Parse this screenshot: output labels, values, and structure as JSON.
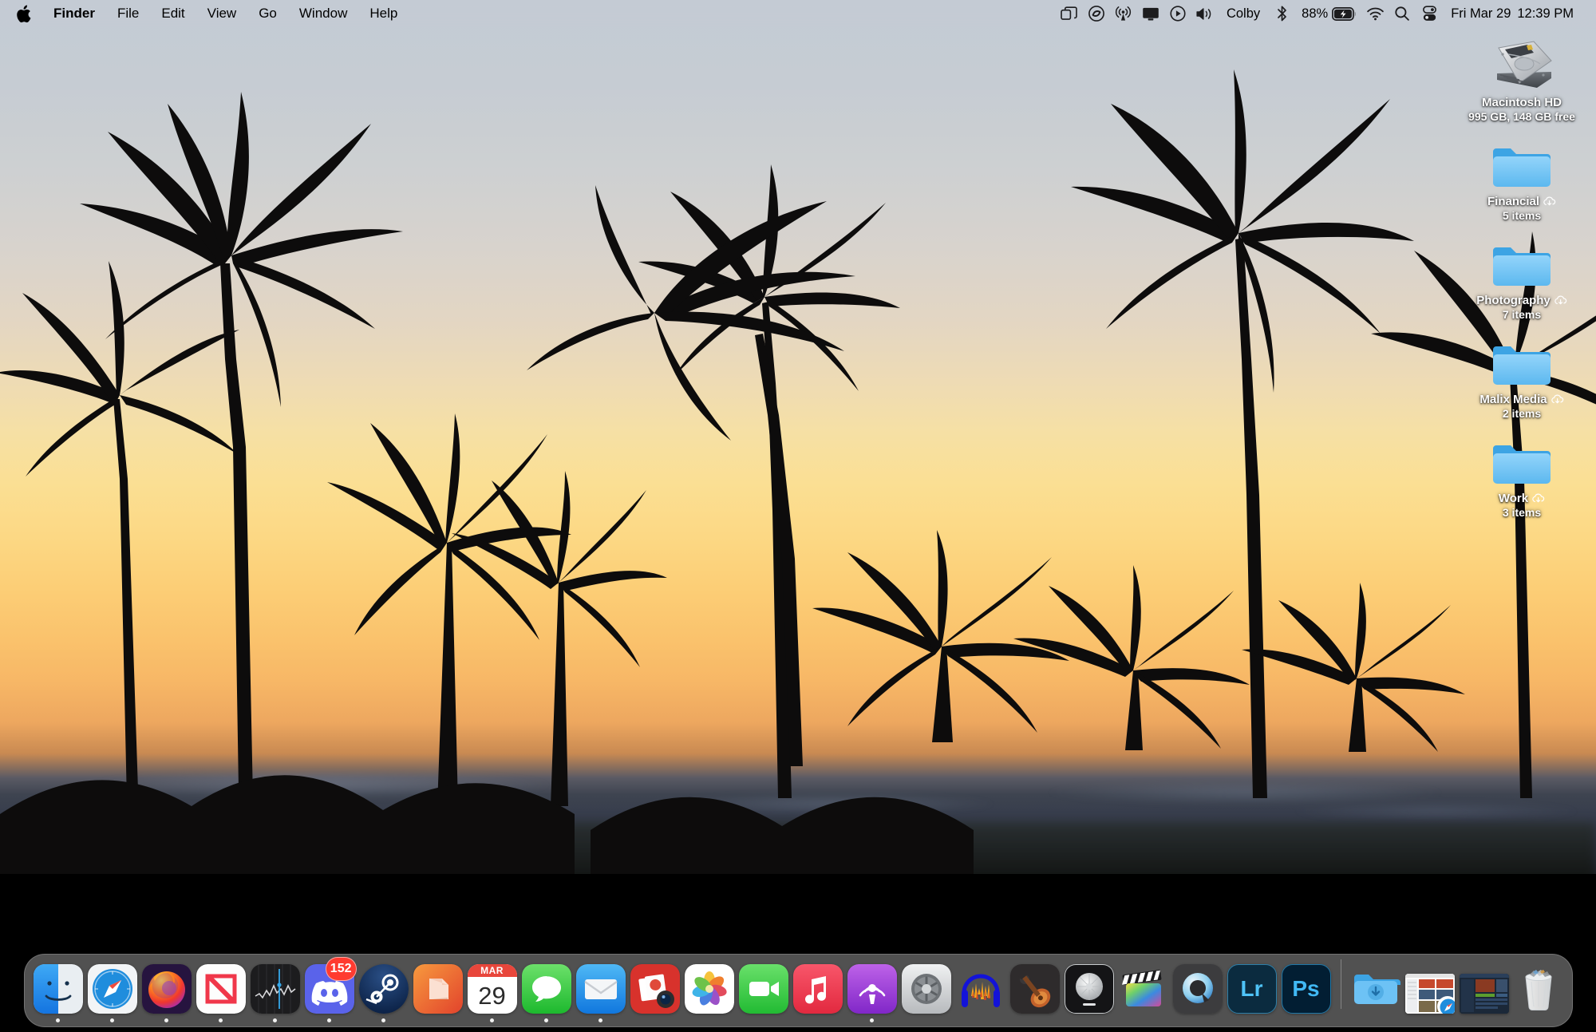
{
  "menubar": {
    "apple_icon": "apple-logo",
    "app_menus": [
      {
        "label": "Finder",
        "bold": true
      },
      {
        "label": "File",
        "bold": false
      },
      {
        "label": "Edit",
        "bold": false
      },
      {
        "label": "View",
        "bold": false
      },
      {
        "label": "Go",
        "bold": false
      },
      {
        "label": "Window",
        "bold": false
      },
      {
        "label": "Help",
        "bold": false
      }
    ],
    "status_icons": [
      "stage-manager-icon",
      "creative-cloud-icon",
      "airplay-broadcast-icon",
      "display-icon",
      "now-playing-icon",
      "volume-icon"
    ],
    "user_name": "Colby",
    "bluetooth_icon": "bluetooth-icon",
    "battery_percent": "88%",
    "battery_icon": "battery-charging-icon",
    "wifi_icon": "wifi-icon",
    "search_icon": "search-icon",
    "control_center_icon": "control-center-icon",
    "date": "Fri Mar 29",
    "time": "12:39 PM"
  },
  "desktop_icons": [
    {
      "name": "Macintosh HD",
      "sub": "995 GB, 148 GB free",
      "type": "hard-drive",
      "cloud": false
    },
    {
      "name": "Financial",
      "sub": "5 items",
      "type": "folder",
      "cloud": true
    },
    {
      "name": "Photography",
      "sub": "7 items",
      "type": "folder",
      "cloud": true
    },
    {
      "name": "Malix Media",
      "sub": "2 items",
      "type": "folder",
      "cloud": true
    },
    {
      "name": "Work",
      "sub": "3 items",
      "type": "folder",
      "cloud": true
    }
  ],
  "dock": {
    "apps": [
      {
        "label": "Finder",
        "icon": "finder-icon",
        "running": true
      },
      {
        "label": "Safari",
        "icon": "safari-icon",
        "running": true
      },
      {
        "label": "Firefox",
        "icon": "firefox-icon",
        "running": true
      },
      {
        "label": "News",
        "icon": "news-icon",
        "running": true
      },
      {
        "label": "Stocks",
        "icon": "stocks-icon",
        "running": true
      },
      {
        "label": "Discord",
        "icon": "discord-icon",
        "running": true,
        "badge": "152"
      },
      {
        "label": "Steam",
        "icon": "steam-icon",
        "running": true
      },
      {
        "label": "Notes",
        "icon": "notes-icon",
        "running": false
      },
      {
        "label": "Calendar",
        "icon": "calendar-icon",
        "running": true,
        "cal_month": "MAR",
        "cal_day": "29"
      },
      {
        "label": "Messages",
        "icon": "messages-icon",
        "running": true
      },
      {
        "label": "Mail",
        "icon": "mail-icon",
        "running": true
      },
      {
        "label": "Photo Booth",
        "icon": "photo-booth-icon",
        "running": false
      },
      {
        "label": "Photos",
        "icon": "photos-icon",
        "running": false
      },
      {
        "label": "FaceTime",
        "icon": "facetime-icon",
        "running": false
      },
      {
        "label": "Music",
        "icon": "music-icon",
        "running": false
      },
      {
        "label": "Podcasts",
        "icon": "podcasts-icon",
        "running": true
      },
      {
        "label": "System Preferences",
        "icon": "system-preferences-icon",
        "running": false
      },
      {
        "label": "Audacity",
        "icon": "audacity-icon",
        "running": false
      },
      {
        "label": "GarageBand",
        "icon": "garageband-icon",
        "running": false
      },
      {
        "label": "Logic Pro",
        "icon": "logic-pro-icon",
        "running": false
      },
      {
        "label": "Final Cut Pro",
        "icon": "final-cut-pro-icon",
        "running": false
      },
      {
        "label": "QuickTime Player",
        "icon": "quicktime-icon",
        "running": false
      },
      {
        "label": "Adobe Lightroom",
        "icon": "lightroom-icon",
        "running": false,
        "text": "Lr"
      },
      {
        "label": "Adobe Photoshop",
        "icon": "photoshop-icon",
        "running": false,
        "text": "Ps"
      }
    ],
    "stacks": [
      {
        "label": "Downloads",
        "icon": "downloads-folder-icon"
      },
      {
        "label": "Minimized Safari Window",
        "icon": "minimized-window-safari"
      },
      {
        "label": "Minimized Steam Window",
        "icon": "minimized-window-steam"
      },
      {
        "label": "Trash",
        "icon": "trash-icon"
      }
    ]
  },
  "colors": {
    "menubar_bg": "#c4cbd4",
    "dock_bg": "#838383",
    "badge_red": "#ff3b30",
    "folder_blue": "#6dc2f5",
    "accent": "#3478f6"
  }
}
